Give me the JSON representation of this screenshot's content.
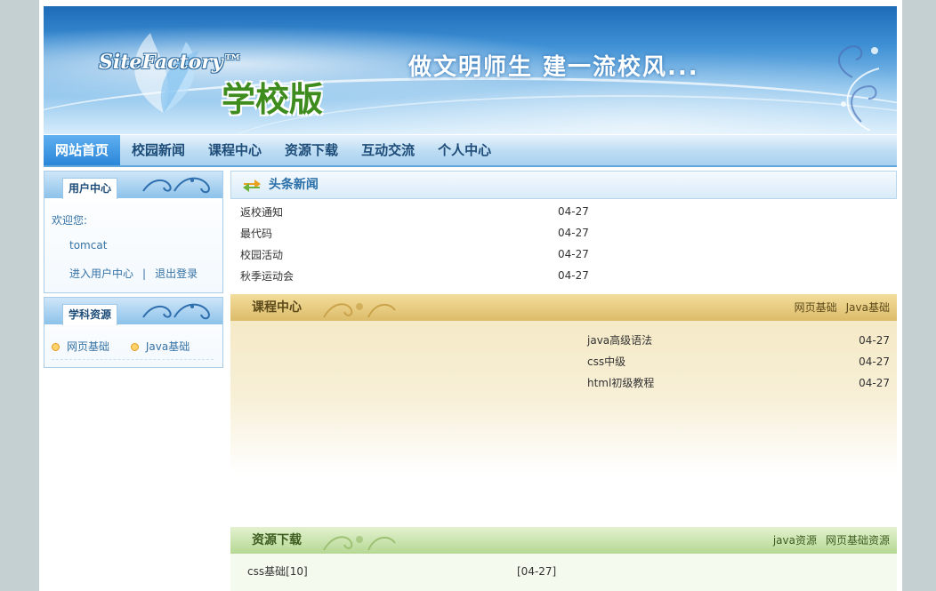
{
  "banner": {
    "brand": "SiteFactory™",
    "edition": "学校版",
    "slogan": "做文明师生 建一流校风..."
  },
  "nav": {
    "items": [
      {
        "label": "网站首页",
        "active": true
      },
      {
        "label": "校园新闻",
        "active": false
      },
      {
        "label": "课程中心",
        "active": false
      },
      {
        "label": "资源下载",
        "active": false
      },
      {
        "label": "互动交流",
        "active": false
      },
      {
        "label": "个人中心",
        "active": false
      }
    ]
  },
  "user_box": {
    "title": "用户中心",
    "welcome": "欢迎您:",
    "username": "tomcat",
    "enter_link": "进入用户中心",
    "separator": "|",
    "logout_link": "退出登录"
  },
  "subject_box": {
    "title": "学科资源",
    "items": [
      "网页基础",
      "Java基础"
    ]
  },
  "headline_news": {
    "title": "头条新闻",
    "items": [
      {
        "title": "返校通知",
        "date": "04-27"
      },
      {
        "title": "最代码",
        "date": "04-27"
      },
      {
        "title": "校园活动",
        "date": "04-27"
      },
      {
        "title": "秋季运动会",
        "date": "04-27"
      }
    ]
  },
  "course_center": {
    "title": "课程中心",
    "links": [
      "网页基础",
      "Java基础"
    ],
    "items": [
      {
        "title": "java高级语法",
        "date": "04-27"
      },
      {
        "title": "css中级",
        "date": "04-27"
      },
      {
        "title": "html初级教程",
        "date": "04-27"
      }
    ]
  },
  "resources": {
    "title": "资源下载",
    "links": [
      "java资源",
      "网页基础资源"
    ],
    "items": [
      {
        "title": "css基础[10]",
        "date": "[04-27]"
      }
    ]
  },
  "colors": {
    "nav_active": "#2b86d8",
    "link_blue": "#3572a5",
    "course_header": "#dcbc6a",
    "resource_header": "#b6d893"
  }
}
